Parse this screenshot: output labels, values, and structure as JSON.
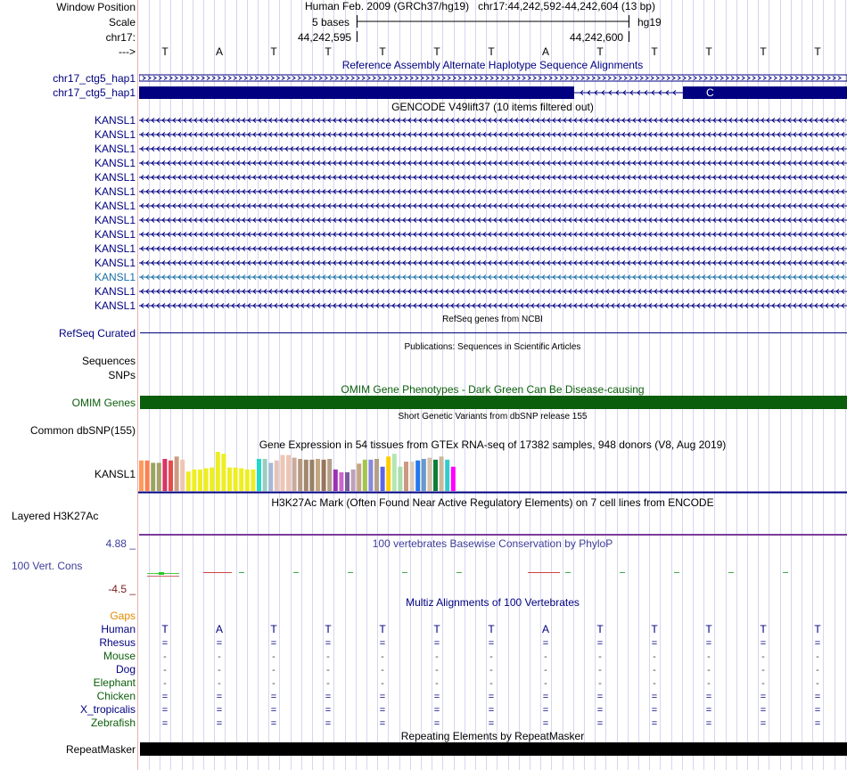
{
  "header": {
    "window_position_label": "Window Position",
    "scale_label": "Scale",
    "chrom_label": "chr17:",
    "arrow_label": "--->",
    "assembly": "Human Feb. 2009 (GRCh37/hg19)",
    "position": "chr17:44,242,592-44,242,604 (13 bp)",
    "scale_text": "5 bases",
    "db": "hg19",
    "coord_left": "44,242,595",
    "coord_right": "44,242,600"
  },
  "sequence": [
    "T",
    "A",
    "T",
    "T",
    "T",
    "T",
    "T",
    "A",
    "T",
    "T",
    "T",
    "T",
    "T"
  ],
  "alt_haplotypes": {
    "title": "Reference Assembly Alternate Haplotype Sequence Alignments",
    "rows": [
      "chr17_ctg5_hap1",
      "chr17_ctg5_hap1"
    ],
    "block_label": "C"
  },
  "gencode": {
    "title": "GENCODE V49lift37 (10 items filtered out)",
    "items": [
      "KANSL1",
      "KANSL1",
      "KANSL1",
      "KANSL1",
      "KANSL1",
      "KANSL1",
      "KANSL1",
      "KANSL1",
      "KANSL1",
      "KANSL1",
      "KANSL1",
      "KANSL1",
      "KANSL1",
      "KANSL1"
    ],
    "highlight_index": 11,
    "color": "#000080",
    "highlight_color": "#1a6ea8"
  },
  "refseq": {
    "title": "RefSeq genes from NCBI",
    "label": "RefSeq Curated"
  },
  "publications": {
    "title": "Publications: Sequences in Scientific Articles",
    "label1": "Sequences",
    "label2": "SNPs"
  },
  "omim": {
    "title": "OMIM Gene Phenotypes - Dark Green Can Be Disease-causing",
    "label": "OMIM Genes",
    "color": "#0b5e0b"
  },
  "dbsnp": {
    "title": "Short Genetic Variants from dbSNP release 155",
    "label": "Common dbSNP(155)"
  },
  "gtex": {
    "title": "Gene Expression in 54 tissues from GTEx RNA-seq of 17382 samples, 948 donors (V8, Aug 2019)",
    "label": "KANSL1",
    "levels": [
      0.78,
      0.78,
      0.72,
      0.72,
      0.82,
      0.78,
      0.88,
      0.8,
      0.5,
      0.55,
      0.55,
      0.58,
      0.6,
      1.0,
      0.95,
      0.6,
      0.6,
      0.58,
      0.55,
      0.55,
      0.82,
      0.82,
      0.72,
      0.78,
      0.92,
      0.92,
      0.85,
      0.82,
      0.8,
      0.8,
      0.82,
      0.8,
      0.82,
      0.55,
      0.48,
      0.48,
      0.55,
      0.7,
      0.8,
      0.8,
      0.82,
      0.62,
      0.88,
      0.95,
      0.62,
      0.75,
      0.75,
      0.78,
      0.82,
      0.85,
      0.8,
      0.88,
      0.8,
      0.62
    ],
    "colors": [
      "#FF9A5C",
      "#FF7F4F",
      "#9AA463",
      "#A8A06A",
      "#D93366",
      "#E64A50",
      "#CC9B80",
      "#EDC6B3",
      "#EEEE22",
      "#EEEE22",
      "#EEEE22",
      "#EEEE22",
      "#EEEE22",
      "#EEEE22",
      "#EEEE22",
      "#EEEE22",
      "#EEEE22",
      "#EEEE22",
      "#EEEE22",
      "#EEEE22",
      "#22D9CC",
      "#9ACDBE",
      "#A6B8D6",
      "#E6C2B8",
      "#EDC6B3",
      "#EDC6B3",
      "#CCAA99",
      "#B39980",
      "#A0876E",
      "#998066",
      "#C4A680",
      "#99755C",
      "#B3A087",
      "#9933B2",
      "#CC66CC",
      "#7A5C9E",
      "#C0A0B8",
      "#C4A680",
      "#A6C44D",
      "#8888DD",
      "#B3A087",
      "#5C66E6",
      "#FFCC00",
      "#B3E6B3",
      "#AADDAA",
      "#CC9980",
      "#DDCCBB",
      "#2277EE",
      "#6699CC",
      "#D9C0A8",
      "#0B7E37",
      "#CDB79E",
      "#33CCCC",
      "#FF00FF"
    ]
  },
  "h3k27ac": {
    "title": "H3K27Ac Mark (Often Found Near Active Regulatory Elements) on 7 cell lines from ENCODE",
    "label": "Layered H3K27Ac"
  },
  "phylop": {
    "title": "100 vertebrates Basewise Conservation by PhyloP",
    "label": "100 Vert. Cons",
    "max": "4.88 _",
    "min": "-4.5 _",
    "title_color": "#3d3d99",
    "max_color": "#3d3d99",
    "min_color": "#7b1a1a"
  },
  "multiz": {
    "title": "Multiz Alignments of 100 Vertebrates",
    "gaps_label": "Gaps",
    "species": [
      {
        "name": "Human",
        "symbol": "T",
        "color": "#000080"
      },
      {
        "name": "Rhesus",
        "symbol": "=",
        "color": "#000080"
      },
      {
        "name": "Mouse",
        "symbol": "-",
        "color": "#0b5e0b"
      },
      {
        "name": "Dog",
        "symbol": "-",
        "color": "#000080"
      },
      {
        "name": "Elephant",
        "symbol": "-",
        "color": "#0b5e0b"
      },
      {
        "name": "Chicken",
        "symbol": "=",
        "color": "#0b5e0b"
      },
      {
        "name": "X_tropicalis",
        "symbol": "=",
        "color": "#000080"
      },
      {
        "name": "Zebrafish",
        "symbol": "=",
        "color": "#0b5e0b"
      }
    ]
  },
  "repeatmasker": {
    "title": "Repeating Elements by RepeatMasker",
    "label": "RepeatMasker"
  }
}
